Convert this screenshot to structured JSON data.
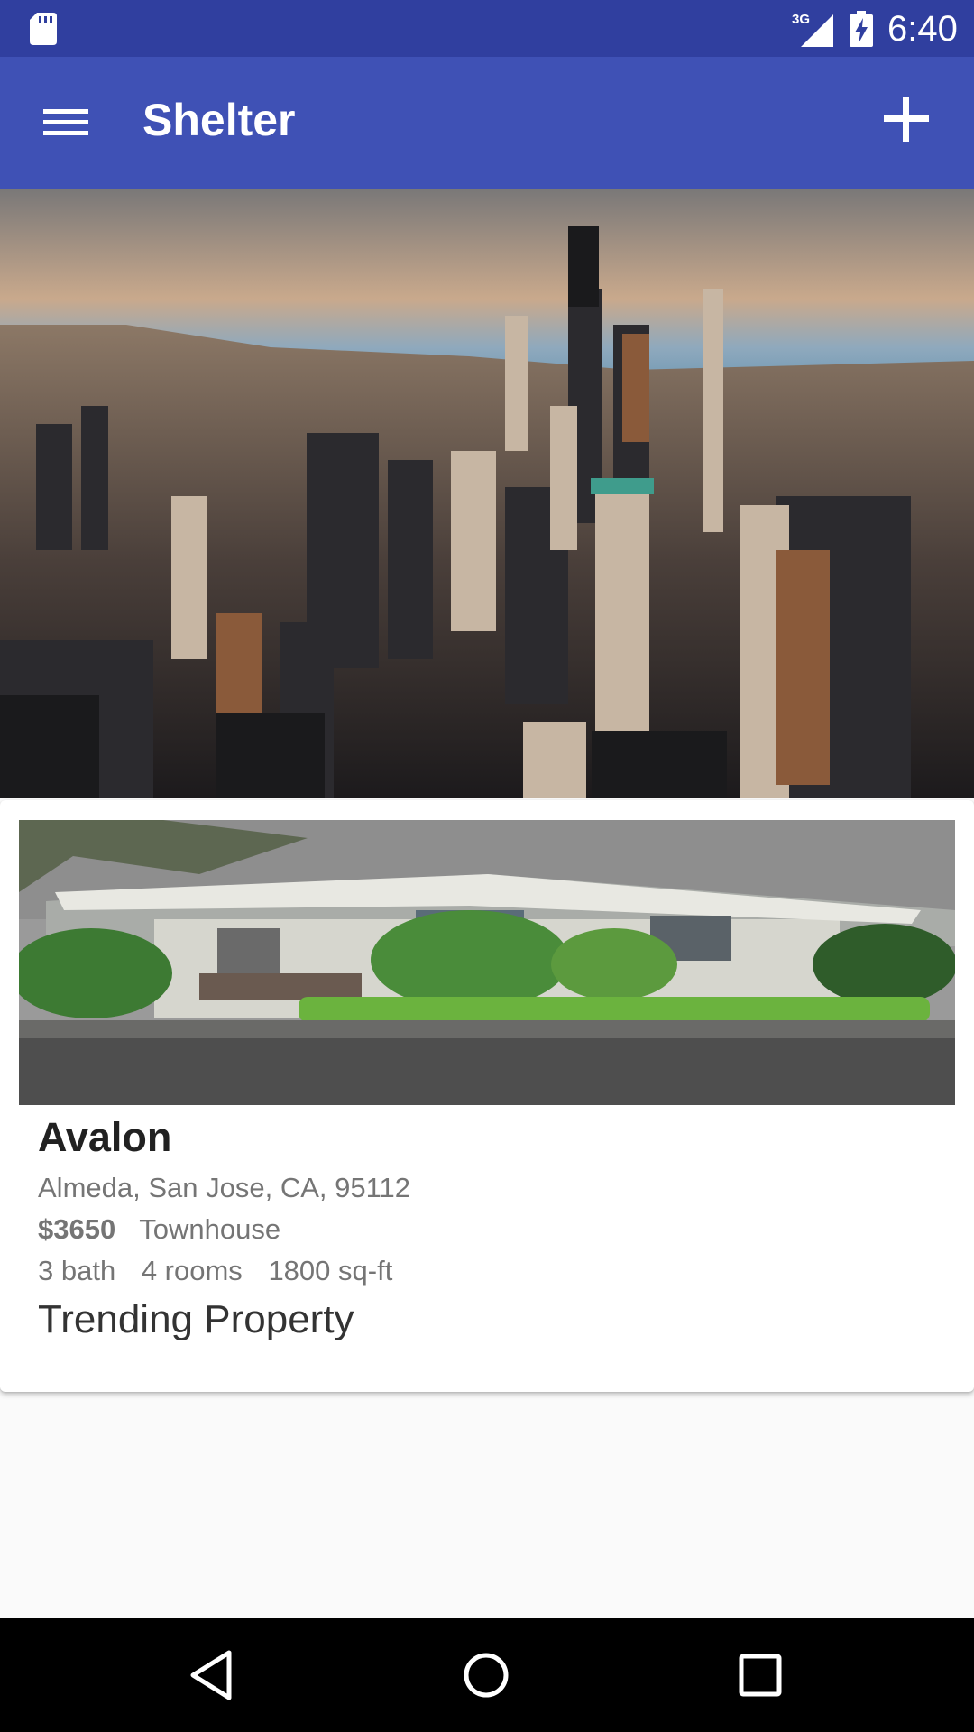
{
  "status_bar": {
    "network": "3G",
    "time": "6:40",
    "icons": [
      "sd-card-icon",
      "signal-icon",
      "battery-charging-icon"
    ]
  },
  "app_bar": {
    "title": "Shelter",
    "menu_icon": "hamburger-menu-icon",
    "add_icon": "plus-icon"
  },
  "colors": {
    "status_bar": "#303f9f",
    "app_bar": "#3f51b5",
    "background": "#fafafa",
    "card": "#ffffff"
  },
  "hero": {
    "image": "city-skyline-photo"
  },
  "property": {
    "image": "house-photo",
    "name": "Avalon",
    "address": "Almeda, San Jose, CA, 95112",
    "price": "$3650",
    "type": "Townhouse",
    "baths": "3 bath",
    "rooms": "4 rooms",
    "area": "1800 sq-ft",
    "tag": "Trending Property"
  },
  "nav_bar": {
    "icons": [
      "back-icon",
      "home-icon",
      "recents-icon"
    ]
  }
}
